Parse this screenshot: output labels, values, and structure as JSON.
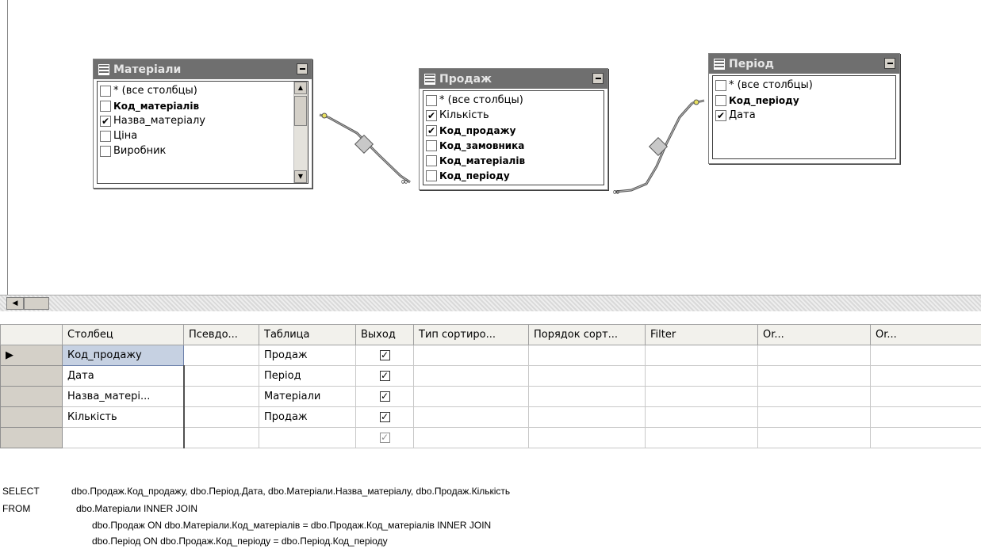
{
  "tables": [
    {
      "title": "Матеріали",
      "columns": [
        {
          "label": "* (все столбцы)",
          "checked": false,
          "bold": false
        },
        {
          "label": "Код_матеріалів",
          "checked": false,
          "bold": true
        },
        {
          "label": "Назва_матеріалу",
          "checked": true,
          "bold": false
        },
        {
          "label": "Ціна",
          "checked": false,
          "bold": false
        },
        {
          "label": "Виробник",
          "checked": false,
          "bold": false
        }
      ]
    },
    {
      "title": "Продаж",
      "columns": [
        {
          "label": "* (все столбцы)",
          "checked": false,
          "bold": false
        },
        {
          "label": "Кількість",
          "checked": true,
          "bold": false
        },
        {
          "label": "Код_продажу",
          "checked": true,
          "bold": true
        },
        {
          "label": "Код_замовника",
          "checked": false,
          "bold": true
        },
        {
          "label": "Код_матеріалів",
          "checked": false,
          "bold": true
        },
        {
          "label": "Код_періоду",
          "checked": false,
          "bold": true
        }
      ]
    },
    {
      "title": "Період",
      "columns": [
        {
          "label": "* (все столбцы)",
          "checked": false,
          "bold": false
        },
        {
          "label": "Код_періоду",
          "checked": false,
          "bold": true
        },
        {
          "label": "Дата",
          "checked": true,
          "bold": false
        }
      ]
    }
  ],
  "grid": {
    "headers": [
      "Столбец",
      "Псевдо...",
      "Таблица",
      "Выход",
      "Тип сортиро...",
      "Порядок сорт...",
      "Filter",
      "Or...",
      "Or..."
    ],
    "rows": [
      {
        "column": "Код_продажу",
        "alias": "",
        "table": "Продаж",
        "output": true
      },
      {
        "column": "Дата",
        "alias": "",
        "table": "Період",
        "output": true
      },
      {
        "column": "Назва_матері...",
        "alias": "",
        "table": "Матеріали",
        "output": true
      },
      {
        "column": "Кількість",
        "alias": "",
        "table": "Продаж",
        "output": true
      },
      {
        "column": "",
        "alias": "",
        "table": "",
        "output": true
      }
    ]
  },
  "sql": {
    "select_kw": "SELECT",
    "select_body": "dbo.Продаж.Код_продажу, dbo.Період.Дата, dbo.Матеріали.Назва_матеріалу, dbo.Продаж.Кількість",
    "from_kw": "FROM",
    "from_line1": "dbo.Матеріали INNER JOIN",
    "from_line2": "dbo.Продаж ON dbo.Матеріали.Код_матеріалів = dbo.Продаж.Код_матеріалів INNER JOIN",
    "from_line3": "dbo.Період ON dbo.Продаж.Код_періоду = dbo.Період.Код_періоду"
  }
}
